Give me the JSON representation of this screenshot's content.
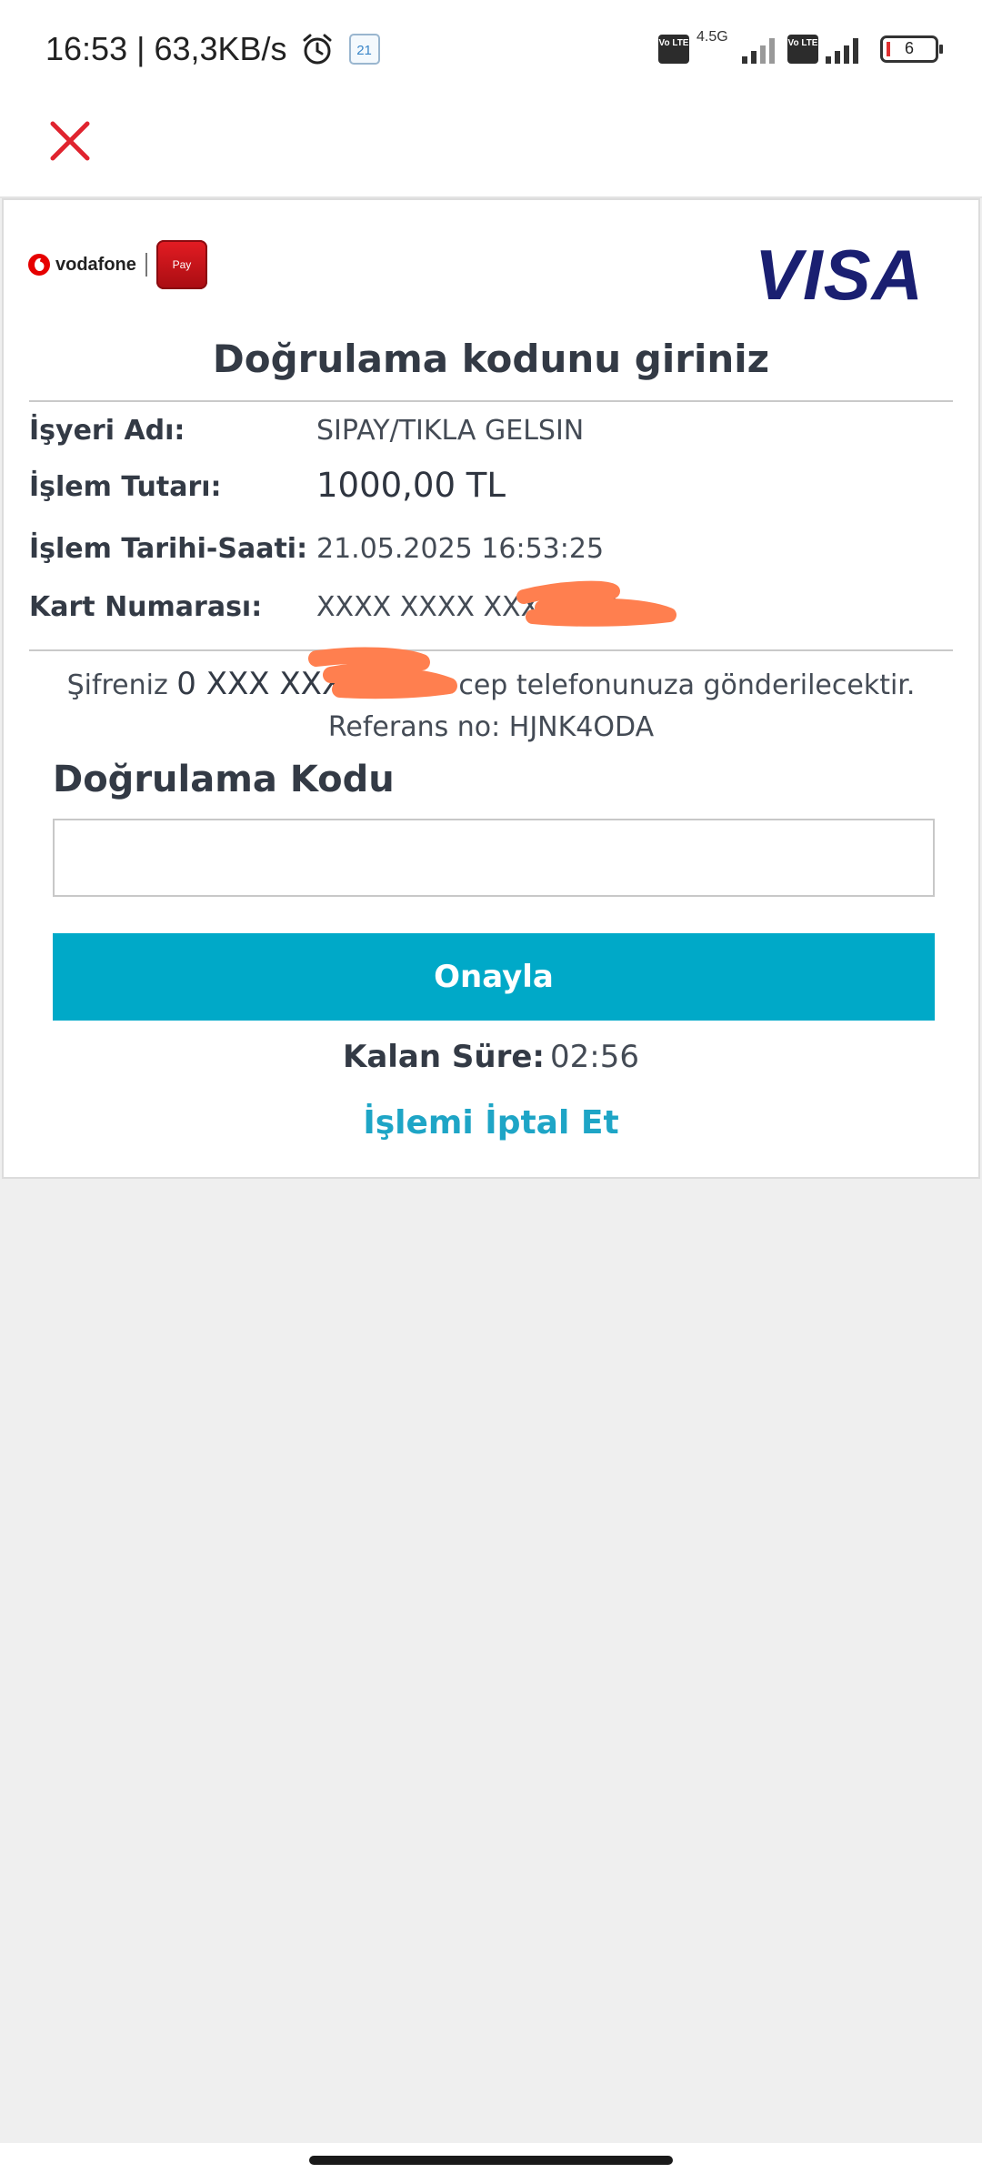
{
  "status_bar": {
    "time_speed": "16:53 | 63,3KB/s",
    "calendar_day": "21",
    "volte_label": "Vo LTE",
    "network_type": "4.5G",
    "battery_level": "6"
  },
  "header": {
    "close_icon": "close-icon"
  },
  "brand": {
    "vodafone_label": "vodafone",
    "pay_label": "Pay",
    "visa_label": "VISA"
  },
  "title": "Doğrulama kodunu giriniz",
  "details": {
    "merchant_label": "İşyeri Adı:",
    "merchant_value": "SIPAY/TIKLA GELSIN",
    "amount_label": "İşlem Tutarı:",
    "amount_value": "1000,00 TL",
    "datetime_label": "İşlem Tarihi-Saati:",
    "datetime_value": "21.05.2025 16:53:25",
    "card_label": "Kart Numarası:",
    "card_value": "XXXX XXXX XXXX 372"
  },
  "sms": {
    "prefix": "Şifreniz ",
    "number": "0 XXX XXX60",
    "suffix": " nolu cep telefonunuza gönderilecektir.",
    "reference": "Referans no: HJNK4ODA"
  },
  "form": {
    "code_label": "Doğrulama Kodu",
    "code_value": "",
    "confirm_label": "Onayla"
  },
  "timer": {
    "label": "Kalan Süre:",
    "value": "02:56"
  },
  "cancel_label": "İşlemi İptal Et",
  "colors": {
    "accent": "#00a9c8",
    "link": "#1ea5c6",
    "close": "#e0242f",
    "visa": "#1a1f71",
    "vodafone": "#e60000",
    "redaction": "#ff7f4f"
  }
}
